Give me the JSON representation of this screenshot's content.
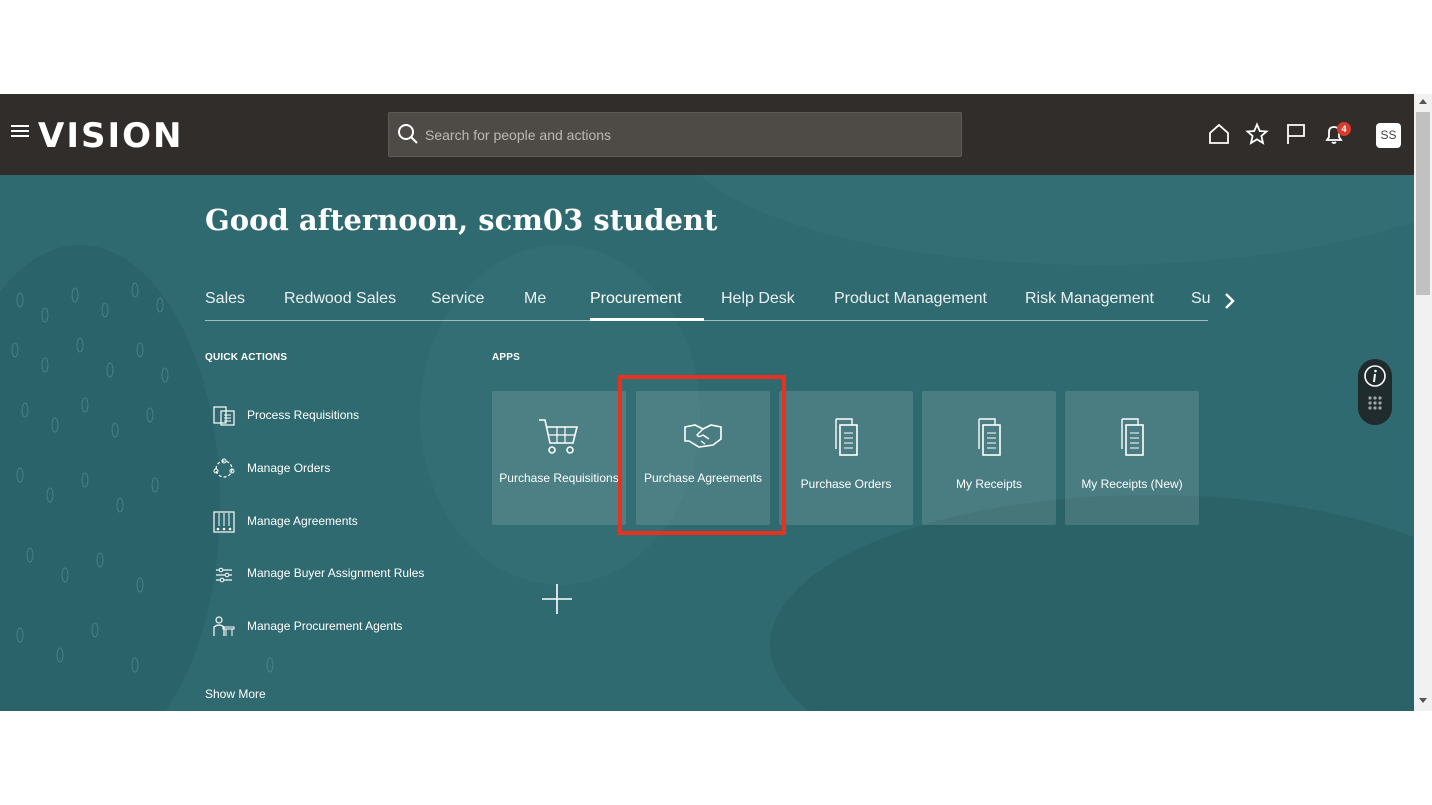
{
  "header": {
    "brand": "VISION",
    "search": {
      "placeholder": "Search for people and actions",
      "value": ""
    },
    "notification_count": "4",
    "avatar_initials": "SS",
    "background_color": "#312d2a"
  },
  "hero": {
    "greeting": "Good afternoon, scm03 student",
    "background_color": "#2f6a70"
  },
  "tabs": [
    {
      "label": "Sales",
      "active": false
    },
    {
      "label": "Redwood Sales",
      "active": false
    },
    {
      "label": "Service",
      "active": false
    },
    {
      "label": "Me",
      "active": false
    },
    {
      "label": "Procurement",
      "active": true
    },
    {
      "label": "Help Desk",
      "active": false
    },
    {
      "label": "Product Management",
      "active": false
    },
    {
      "label": "Risk Management",
      "active": false
    },
    {
      "label": "Su",
      "active": false
    }
  ],
  "quick_actions": {
    "heading": "QUICK ACTIONS",
    "items": [
      {
        "label": "Process Requisitions",
        "icon": "document-list-icon"
      },
      {
        "label": "Manage Orders",
        "icon": "order-cycle-icon"
      },
      {
        "label": "Manage Agreements",
        "icon": "agreements-icon"
      },
      {
        "label": "Manage Buyer Assignment Rules",
        "icon": "rules-icon"
      },
      {
        "label": "Manage Procurement Agents",
        "icon": "agent-icon"
      }
    ],
    "show_more": "Show More"
  },
  "apps": {
    "heading": "APPS",
    "items": [
      {
        "label": "Purchase Requisitions",
        "icon": "cart-icon"
      },
      {
        "label": "Purchase Agreements",
        "icon": "handshake-icon",
        "highlighted": true
      },
      {
        "label": "Purchase Orders",
        "icon": "documents-icon"
      },
      {
        "label": "My Receipts",
        "icon": "documents-icon"
      },
      {
        "label": "My Receipts (New)",
        "icon": "documents-icon"
      }
    ]
  },
  "highlight_color": "#e8321f"
}
